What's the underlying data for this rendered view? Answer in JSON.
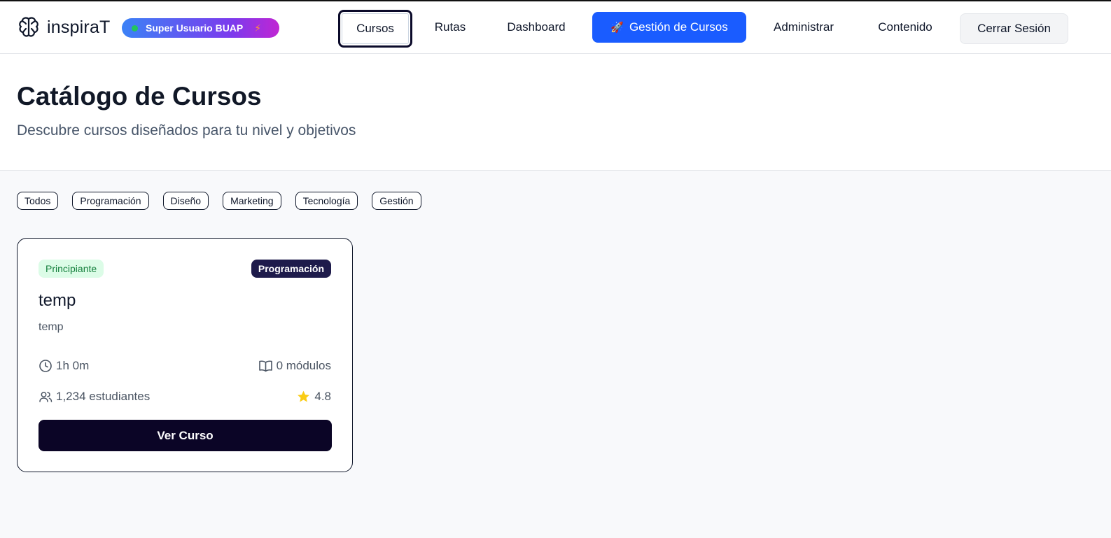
{
  "brand": {
    "name": "inspiraT",
    "icon": "brain-icon"
  },
  "user_badge": {
    "label": "Super Usuario BUAP",
    "status_color": "#22c55e",
    "icon": "bolt-icon"
  },
  "nav": {
    "cursos": "Cursos",
    "rutas": "Rutas",
    "dashboard": "Dashboard",
    "gestion": "Gestión de Cursos",
    "gestion_icon": "rocket-icon",
    "administrar": "Administrar",
    "contenido": "Contenido",
    "logout": "Cerrar Sesión",
    "active": "Cursos"
  },
  "hero": {
    "title": "Catálogo de Cursos",
    "subtitle": "Descubre cursos diseñados para tu nivel y objetivos"
  },
  "filters": [
    "Todos",
    "Programación",
    "Diseño",
    "Marketing",
    "Tecnología",
    "Gestión"
  ],
  "courses": [
    {
      "level": "Principiante",
      "category": "Programación",
      "title": "temp",
      "description": "temp",
      "duration": "1h 0m",
      "modules": "0 módulos",
      "students": "1,234 estudiantes",
      "rating": "4.8",
      "button": "Ver Curso"
    }
  ],
  "colors": {
    "accent": "#1a5cff",
    "level_bg": "#dcfce7",
    "level_text": "#15803d",
    "category_bg": "#1e1b4b",
    "button_bg": "#0b0526",
    "star": "#facc15"
  }
}
